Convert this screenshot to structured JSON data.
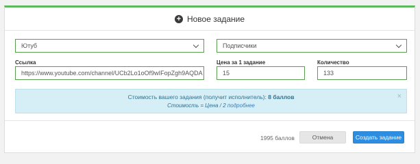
{
  "header": {
    "title": "Новое задание",
    "icon": "plus-circle-icon"
  },
  "form": {
    "service_select": {
      "value": "Ютуб"
    },
    "type_select": {
      "value": "Подписчики"
    },
    "link": {
      "label": "Ссылка",
      "value": "https://www.youtube.com/channel/UCb2Lo1oOf9wIFopZgh9AQDA"
    },
    "price": {
      "label": "Цена за 1 задание",
      "value": "15"
    },
    "quantity": {
      "label": "Количество",
      "value": "133"
    }
  },
  "info": {
    "line1_prefix": "Стоимость вашего задания (получит исполнитель): ",
    "line1_value": "8 баллов",
    "line2_prefix": "Стоимость = Цена / 2 ",
    "line2_link": "подробнее",
    "close_symbol": "×"
  },
  "footer": {
    "balance": "1995 баллов",
    "cancel_label": "Отмена",
    "create_label": "Создать задание"
  },
  "colors": {
    "accent_green": "#5cb85c",
    "primary_blue": "#2d8de0",
    "info_bg": "#d6eef6"
  }
}
